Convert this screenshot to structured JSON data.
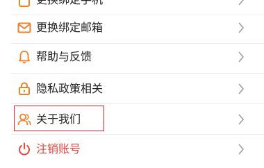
{
  "colors": {
    "accent": "#f0802a",
    "danger": "#e8453c",
    "highlight": "#e0242a",
    "text": "#222222",
    "chevron": "#9a9a9a",
    "divider": "#e9e9e9"
  },
  "menu": {
    "items": [
      {
        "label": "更换绑定手机",
        "icon": "phone-icon"
      },
      {
        "label": "更换绑定邮箱",
        "icon": "mail-icon"
      },
      {
        "label": "帮助与反馈",
        "icon": "bell-icon"
      },
      {
        "label": "隐私政策相关",
        "icon": "lock-icon"
      },
      {
        "label": "关于我们",
        "icon": "users-icon"
      },
      {
        "label": "注销账号",
        "icon": "power-icon"
      }
    ]
  }
}
